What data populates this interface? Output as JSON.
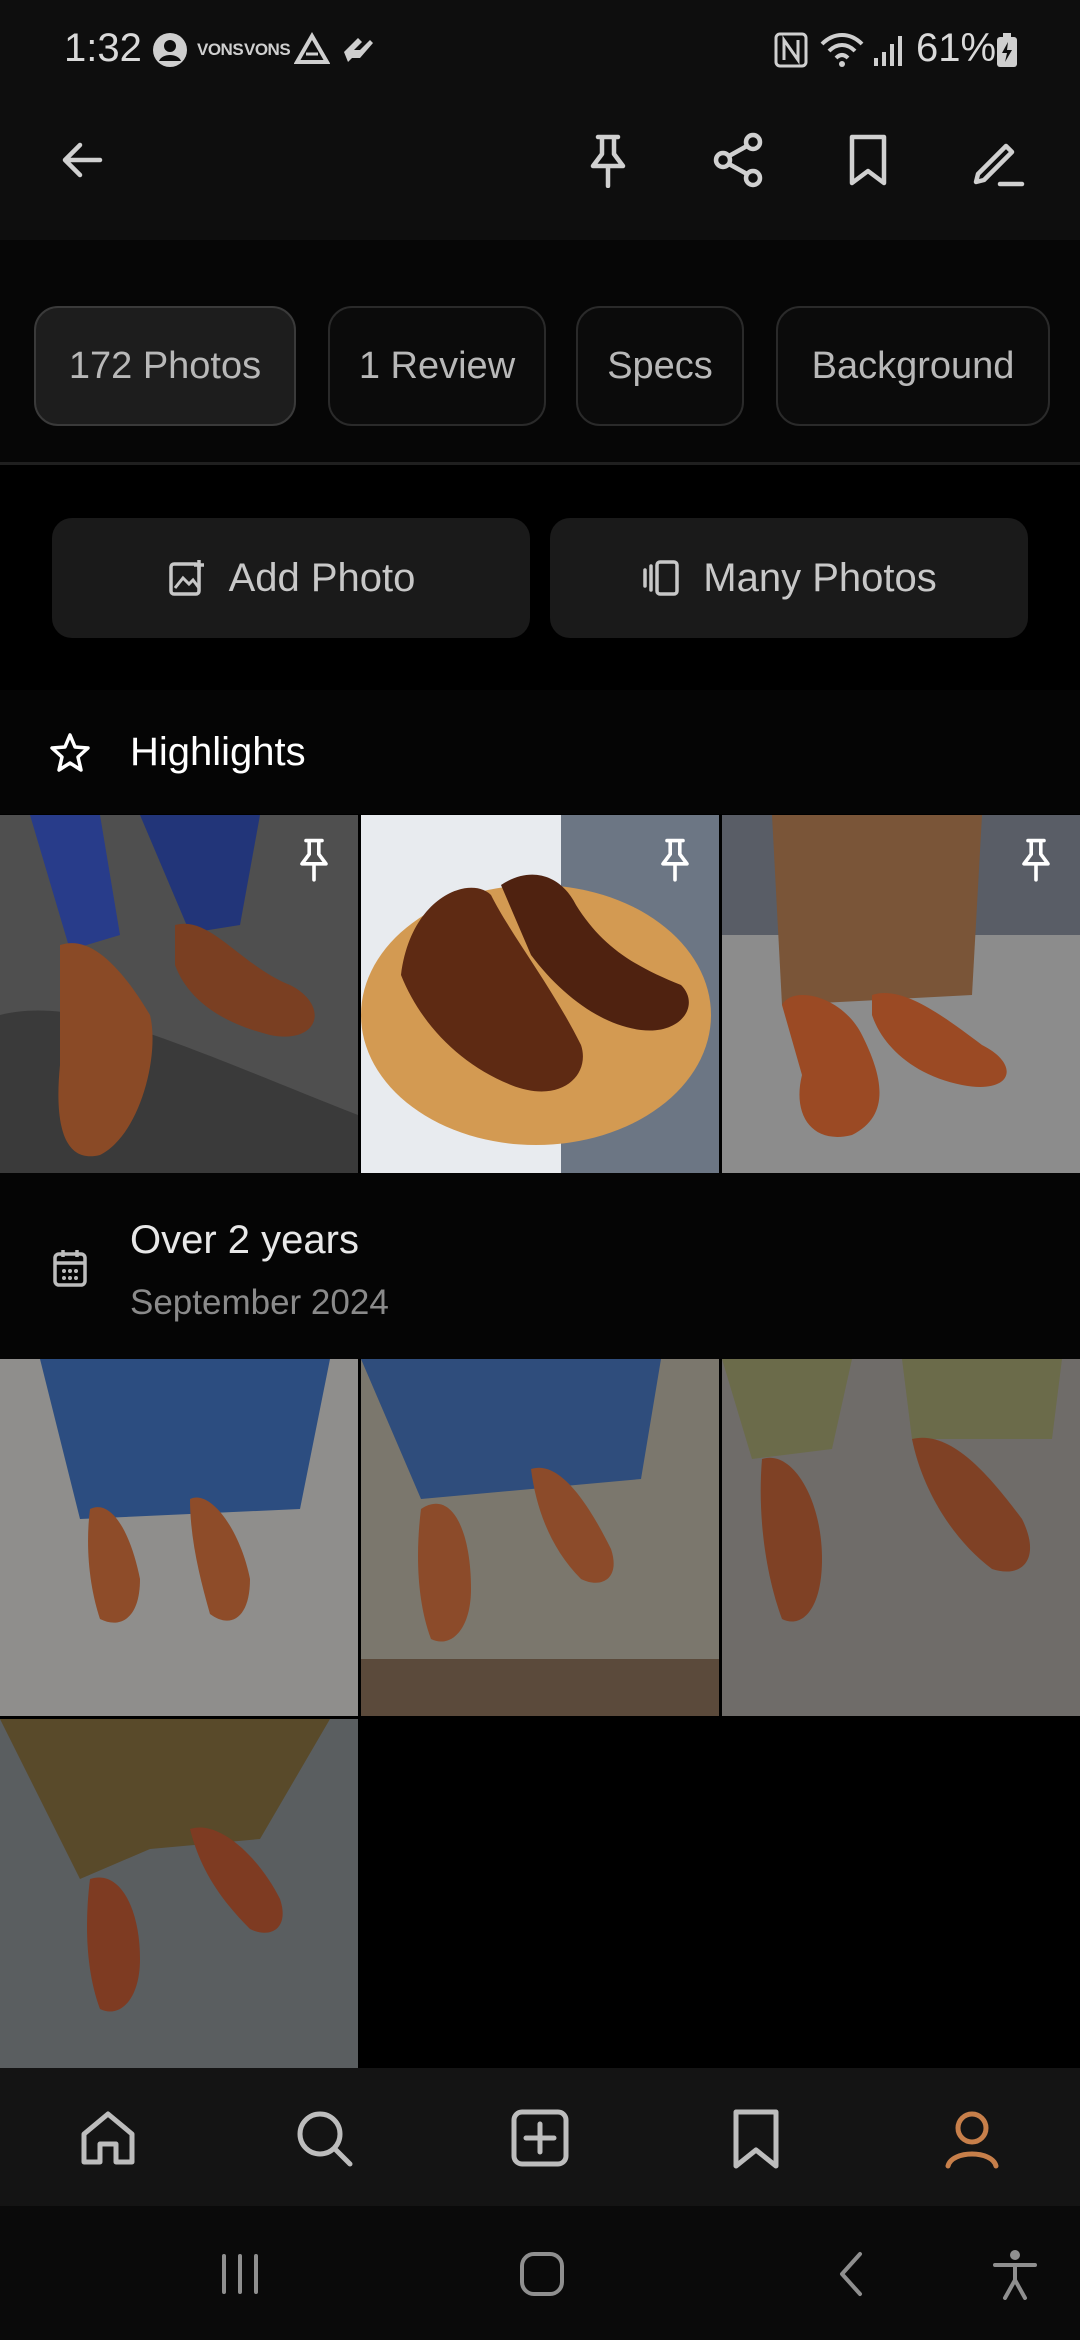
{
  "status_bar": {
    "time": "1:32",
    "notif_1": "VONS",
    "notif_2": "VONS",
    "battery": "61%"
  },
  "app_bar": {
    "back_icon": "back-arrow-icon",
    "actions": [
      "pin-icon",
      "share-icon",
      "bookmark-icon",
      "edit-icon"
    ]
  },
  "tabs": [
    {
      "label": "172 Photos",
      "active": true
    },
    {
      "label": "1 Review",
      "active": false
    },
    {
      "label": "Specs",
      "active": false
    },
    {
      "label": "Background",
      "active": false
    }
  ],
  "actions": {
    "add_photo": "Add Photo",
    "many_photos": "Many Photos"
  },
  "highlights": {
    "title": "Highlights"
  },
  "timeline": {
    "title": "Over 2 years",
    "subtitle": "September 2024"
  },
  "bottom_nav": [
    "home-icon",
    "search-icon",
    "add-icon",
    "bookmark-icon",
    "profile-icon"
  ],
  "colors": {
    "accent": "#c77f4a",
    "background": "#000000",
    "chip_active": "#1d1d1d"
  }
}
